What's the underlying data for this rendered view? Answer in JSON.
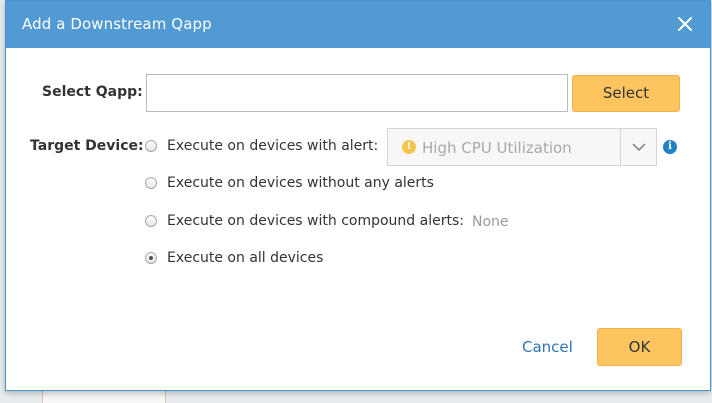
{
  "dialog": {
    "title": "Add a Downstream Qapp",
    "close_icon": "close-icon"
  },
  "select_qapp": {
    "label": "Select Qapp:",
    "input_value": "",
    "button_label": "Select"
  },
  "target_device": {
    "label": "Target Device:",
    "options": [
      {
        "label": "Execute on devices with alert:",
        "checked": false
      },
      {
        "label": "Execute on devices without any alerts",
        "checked": false
      },
      {
        "label": "Execute on devices with compound alerts:",
        "checked": false
      },
      {
        "label": "Execute on all devices",
        "checked": true
      }
    ],
    "alert_dropdown": {
      "value": "High CPU Utilization",
      "icon": "warning-icon",
      "disabled": true
    },
    "info_icon": "info-icon",
    "compound_alerts_value": "None"
  },
  "footer": {
    "cancel_label": "Cancel",
    "ok_label": "OK"
  },
  "colors": {
    "titlebar": "#519ad3",
    "button_yellow": "#fdc45f",
    "link_blue": "#2e74b5",
    "info_blue": "#1f83c6"
  }
}
